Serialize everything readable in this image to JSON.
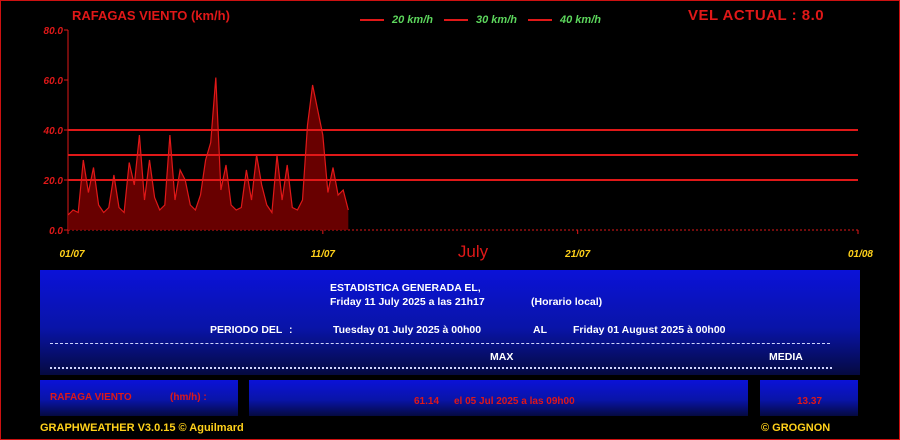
{
  "header": {
    "title": "RAFAGAS VIENTO (km/h)",
    "current": "VEL ACTUAL : 8.0",
    "legend": [
      "20 km/h",
      "30 km/h",
      "40 km/h"
    ]
  },
  "chart_data": {
    "type": "area",
    "title": "RAFAGAS VIENTO (km/h)",
    "ylim": [
      0,
      80
    ],
    "yticks": [
      "0.0",
      "20.0",
      "40.0",
      "60.0",
      "80.0"
    ],
    "xticks": [
      {
        "label": "01/07",
        "day": 0
      },
      {
        "label": "11/07",
        "day": 10
      },
      {
        "label": "21/07",
        "day": 20
      },
      {
        "label": "01/08",
        "day": 31
      }
    ],
    "xlim_days": [
      0,
      31
    ],
    "month_label": "July",
    "reference_lines": [
      20,
      30,
      40
    ],
    "series": [
      {
        "x_days": [
          0,
          0.2,
          0.4,
          0.6,
          0.8,
          1.0,
          1.2,
          1.4,
          1.6,
          1.8,
          2.0,
          2.2,
          2.4,
          2.6,
          2.8,
          3.0,
          3.2,
          3.4,
          3.6,
          3.8,
          4.0,
          4.2,
          4.4,
          4.6,
          4.8,
          5.0,
          5.2,
          5.4,
          5.6,
          5.8,
          6.0,
          6.2,
          6.4,
          6.6,
          6.8,
          7.0,
          7.2,
          7.4,
          7.6,
          7.8,
          8.0,
          8.2,
          8.4,
          8.6,
          8.8,
          9.0,
          9.2,
          9.4,
          9.6,
          9.8,
          10.0,
          10.2,
          10.4,
          10.6,
          10.8,
          11.0
        ],
        "values": [
          6,
          8,
          7,
          28,
          15,
          25,
          10,
          7,
          9,
          22,
          9,
          7,
          27,
          18,
          38,
          12,
          28,
          13,
          8,
          10,
          38,
          12,
          24,
          20,
          10,
          8,
          14,
          28,
          35,
          61,
          16,
          26,
          10,
          8,
          9,
          24,
          12,
          30,
          18,
          10,
          7,
          30,
          12,
          26,
          9,
          8,
          12,
          42,
          58,
          48,
          38,
          15,
          25,
          14,
          16,
          8
        ]
      }
    ]
  },
  "stats": {
    "generated_label": "ESTADISTICA GENERADA EL,",
    "generated_date": "Friday 11 July 2025 a las 21h17",
    "local_time": "(Horario local)",
    "period_label": "PERIODO DEL",
    "period_colon": ":",
    "period_start": "Tuesday 01 July 2025 à 00h00",
    "al": "AL",
    "period_end": "Friday 01 August 2025 à 00h00",
    "max_header": "MAX",
    "media_header": "MEDIA"
  },
  "row": {
    "label": "RAFAGA VIENTO",
    "unit": "(hm/h) :",
    "max_value": "61.14",
    "max_when": "el 05 Jul 2025 a las 09h00",
    "media": "13.37"
  },
  "footer": {
    "left": "GRAPHWEATHER V3.0.15 © Aguilmard",
    "right": "© GROGNON"
  },
  "colors": {
    "accent_red": "#e01818",
    "legend_green": "#5cd65c",
    "footer_yellow": "#ffd11a",
    "panel_blue": "#0b12d8"
  }
}
